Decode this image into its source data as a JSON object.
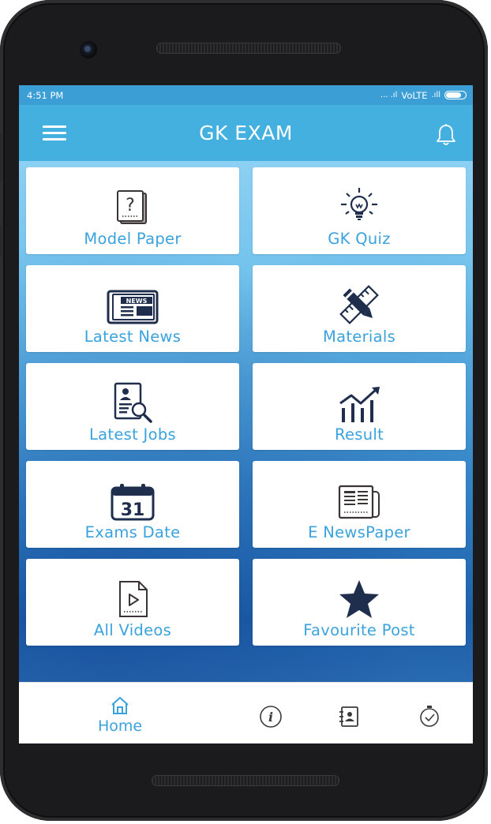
{
  "status_bar": {
    "time": "4:51 PM",
    "signal_text": "... .ıl",
    "network": "VoLTE",
    "signal2": ".ıll"
  },
  "app_bar": {
    "title": "GK EXAM",
    "menu_icon": "hamburger-menu-icon",
    "notification_icon": "bell-icon"
  },
  "tiles": [
    {
      "label": "Model Paper",
      "icon": "question-paper-icon"
    },
    {
      "label": "GK Quiz",
      "icon": "lightbulb-icon"
    },
    {
      "label": "Latest News",
      "icon": "newspaper-icon"
    },
    {
      "label": "Materials",
      "icon": "pencil-ruler-icon"
    },
    {
      "label": "Latest Jobs",
      "icon": "job-search-icon"
    },
    {
      "label": "Result",
      "icon": "chart-growth-icon"
    },
    {
      "label": "Exams Date",
      "icon": "calendar-icon",
      "calendar_day": "31"
    },
    {
      "label": "E NewsPaper",
      "icon": "e-newspaper-icon"
    },
    {
      "label": "All Videos",
      "icon": "video-file-icon"
    },
    {
      "label": "Favourite Post",
      "icon": "star-icon"
    }
  ],
  "bottom_nav": {
    "home_label": "Home",
    "items": [
      "home-icon",
      "info-icon",
      "contact-book-icon",
      "timer-icon"
    ]
  },
  "colors": {
    "status_bar": "#3b9fd6",
    "app_bar": "#43b0e0",
    "accent_text": "#3aa2dc",
    "icon_dark": "#1f2e4d"
  }
}
